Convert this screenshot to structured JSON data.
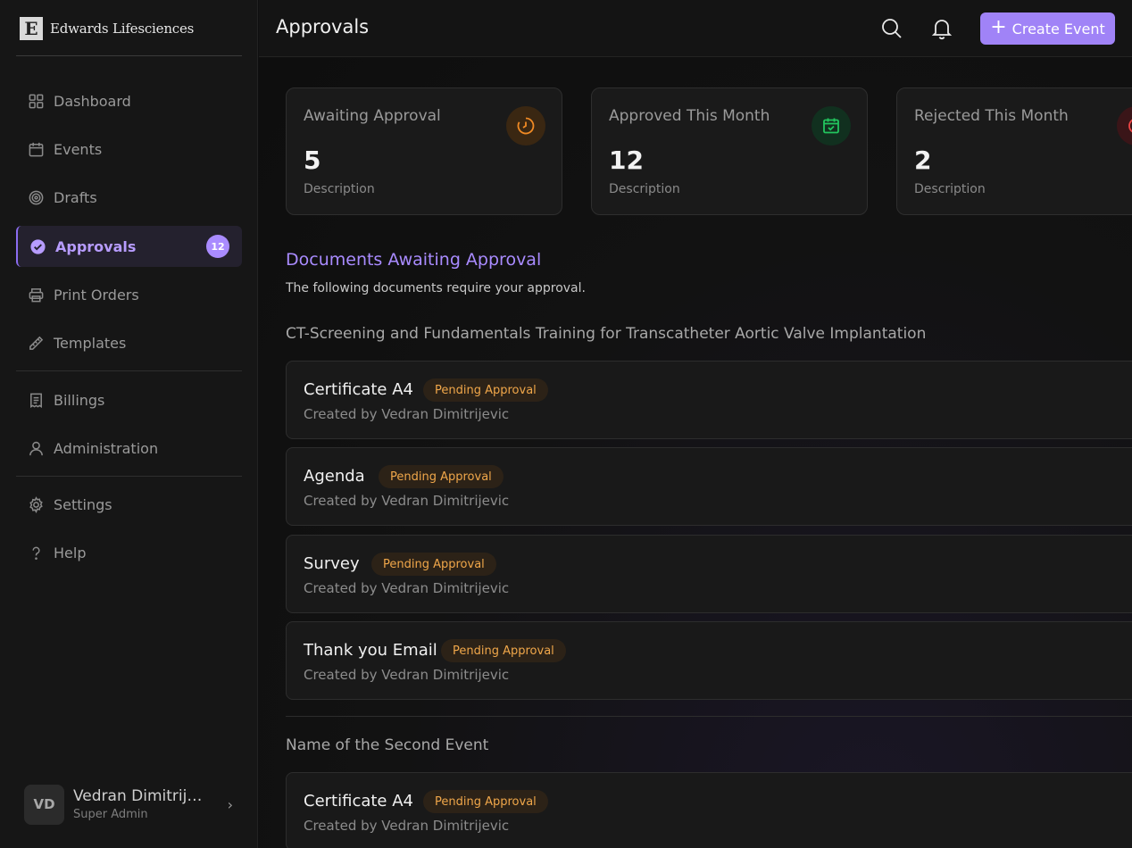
{
  "brand": {
    "logo_letter": "E",
    "name": "Edwards Lifesciences"
  },
  "sidebar": {
    "items": [
      {
        "label": "Dashboard"
      },
      {
        "label": "Events"
      },
      {
        "label": "Drafts"
      },
      {
        "label": "Approvals",
        "badge": "12",
        "active": true
      },
      {
        "label": "Print Orders"
      },
      {
        "label": "Templates"
      },
      {
        "label": "Billings"
      },
      {
        "label": "Administration"
      },
      {
        "label": "Settings"
      },
      {
        "label": "Help"
      }
    ],
    "user": {
      "initials": "VD",
      "name": "Vedran Dimitrijevic",
      "role": "Super Admin"
    }
  },
  "header": {
    "title": "Approvals",
    "create_label": "Create Event"
  },
  "stats": [
    {
      "label": "Awaiting Approval",
      "value": "5",
      "description": "Description",
      "icon": "timer-icon",
      "color": "#f08a24"
    },
    {
      "label": "Approved This Month",
      "value": "12",
      "description": "Description",
      "icon": "calendar-check-icon",
      "color": "#22c55e"
    },
    {
      "label": "Rejected This Month",
      "value": "2",
      "description": "Description",
      "icon": "x-circle-icon",
      "color": "#ef4444"
    }
  ],
  "section": {
    "title": "Documents Awaiting Approval",
    "subtitle": "The following documents require your approval."
  },
  "events": [
    {
      "name": "CT-Screening and Fundamentals Training for Transcatheter Aortic Valve Implantation",
      "documents": [
        {
          "title": "Certificate A4",
          "status": "Pending Approval",
          "creator": "Created by Vedran Dimitrijevic"
        },
        {
          "title": "Agenda",
          "status": "Pending Approval",
          "creator": "Created by Vedran Dimitrijevic"
        },
        {
          "title": "Survey",
          "status": "Pending Approval",
          "creator": "Created by Vedran Dimitrijevic"
        },
        {
          "title": "Thank you Email",
          "status": "Pending Approval",
          "creator": "Created by Vedran Dimitrijevic"
        }
      ]
    },
    {
      "name": "Name of the Second Event",
      "documents": [
        {
          "title": "Certificate A4",
          "status": "Pending Approval",
          "creator": "Created by Vedran Dimitrijevic"
        }
      ]
    }
  ],
  "colors": {
    "accent": "#a083f7",
    "pending_text": "#f0a74a",
    "pending_bg": "#2c2217"
  }
}
